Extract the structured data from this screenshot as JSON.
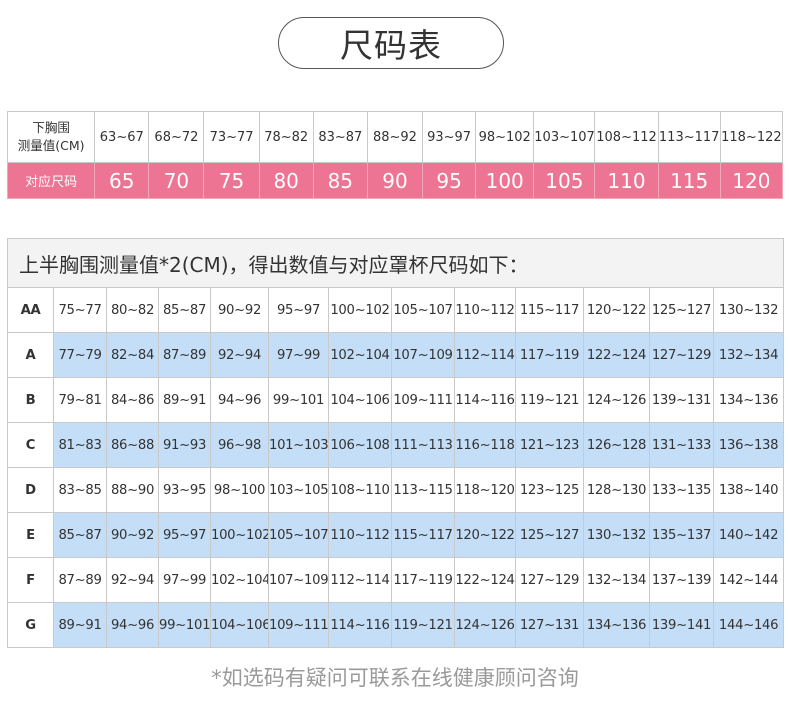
{
  "title": "尺码表",
  "band_table": {
    "header_label": "下胸围\n测量值(CM)",
    "ranges": [
      "63~67",
      "68~72",
      "73~77",
      "78~82",
      "83~87",
      "88~92",
      "93~97",
      "98~102",
      "103~107",
      "108~112",
      "113~117",
      "118~122"
    ],
    "size_label": "对应尺码",
    "sizes": [
      "65",
      "70",
      "75",
      "80",
      "85",
      "90",
      "95",
      "100",
      "105",
      "110",
      "115",
      "120"
    ]
  },
  "cup_table": {
    "caption": "上半胸围测量值*2(CM)，得出数值与对应罩杯尺码如下：",
    "rows": [
      {
        "cup": "AA",
        "values": [
          "75~77",
          "80~82",
          "85~87",
          "90~92",
          "95~97",
          "100~102",
          "105~107",
          "110~112",
          "115~117",
          "120~122",
          "125~127",
          "130~132"
        ]
      },
      {
        "cup": "A",
        "values": [
          "77~79",
          "82~84",
          "87~89",
          "92~94",
          "97~99",
          "102~104",
          "107~109",
          "112~114",
          "117~119",
          "122~124",
          "127~129",
          "132~134"
        ]
      },
      {
        "cup": "B",
        "values": [
          "79~81",
          "84~86",
          "89~91",
          "94~96",
          "99~101",
          "104~106",
          "109~111",
          "114~116",
          "119~121",
          "124~126",
          "139~131",
          "134~136"
        ]
      },
      {
        "cup": "C",
        "values": [
          "81~83",
          "86~88",
          "91~93",
          "96~98",
          "101~103",
          "106~108",
          "111~113",
          "116~118",
          "121~123",
          "126~128",
          "131~133",
          "136~138"
        ]
      },
      {
        "cup": "D",
        "values": [
          "83~85",
          "88~90",
          "93~95",
          "98~100",
          "103~105",
          "108~110",
          "113~115",
          "118~120",
          "123~125",
          "128~130",
          "133~135",
          "138~140"
        ]
      },
      {
        "cup": "E",
        "values": [
          "85~87",
          "90~92",
          "95~97",
          "100~102",
          "105~107",
          "110~112",
          "115~117",
          "120~122",
          "125~127",
          "130~132",
          "135~137",
          "140~142"
        ]
      },
      {
        "cup": "F",
        "values": [
          "87~89",
          "92~94",
          "97~99",
          "102~104",
          "107~109",
          "112~114",
          "117~119",
          "122~124",
          "127~129",
          "132~134",
          "137~139",
          "142~144"
        ]
      },
      {
        "cup": "G",
        "values": [
          "89~91",
          "94~96",
          "99~101",
          "104~106",
          "109~111",
          "114~116",
          "119~121",
          "124~126",
          "127~131",
          "134~136",
          "139~141",
          "144~146"
        ]
      }
    ]
  },
  "footnote": "*如选码有疑问可联系在线健康顾问咨询",
  "colors": {
    "pink": "#ed7493",
    "blue_row": "#c4def8",
    "cup_letter": "#3a75c8"
  }
}
